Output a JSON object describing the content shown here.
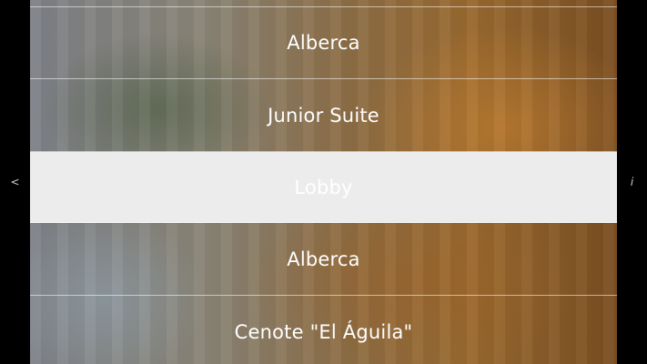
{
  "nav": {
    "back_label": "<",
    "info_label": "i"
  },
  "list": {
    "items": [
      {
        "label": ""
      },
      {
        "label": "Alberca"
      },
      {
        "label": "Junior Suite"
      },
      {
        "label": "Lobby",
        "selected": true
      },
      {
        "label": "Alberca"
      },
      {
        "label": "Cenote \"El Águila\""
      }
    ],
    "selected_index": 3
  },
  "colors": {
    "side_bar": "#000000",
    "selected_row": "#ececec",
    "text": "#ffffff"
  }
}
